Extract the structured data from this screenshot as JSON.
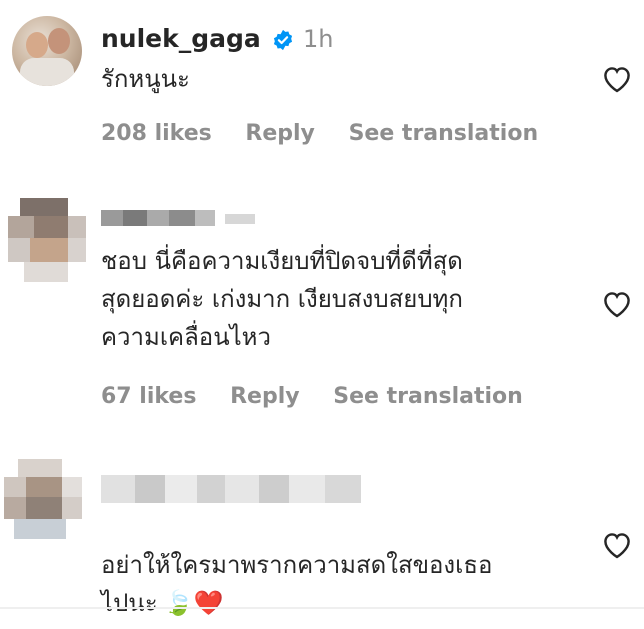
{
  "comments": [
    {
      "username": "nulek_gaga",
      "verified": true,
      "time": "1h",
      "text": "รักหนูนะ",
      "likes": "208 likes",
      "reply": "Reply",
      "translation": "See translation"
    },
    {
      "username": "",
      "text": "ชอบ นี่คือความเงียบที่ปิดจบที่ดีที่สุด\nสุดยอดค่ะ เก่งมาก เงียบสงบสยบทุก\nความเคลื่อนไหว",
      "likes": "67 likes",
      "reply": "Reply",
      "translation": "See translation"
    },
    {
      "username": "",
      "text": "อย่าให้ใครมาพรากความสดใสของเธอ\nไปนะ",
      "emoji": "🍃❤️"
    }
  ],
  "colors": {
    "text": "#262626",
    "muted": "#8e8e8e",
    "verified": "#0095f6",
    "heart_emoji": "#e0162b"
  }
}
